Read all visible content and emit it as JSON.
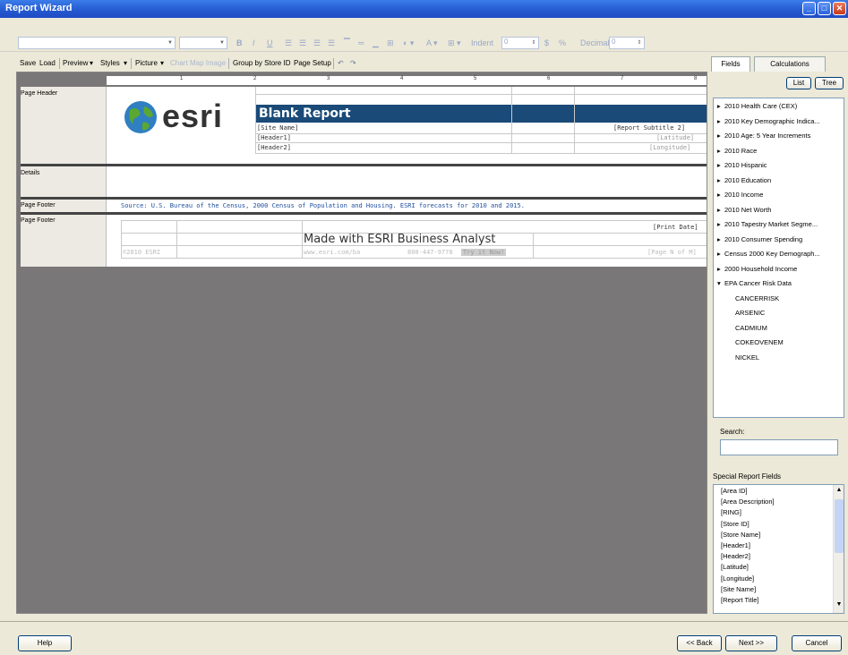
{
  "window": {
    "title": "Report Wizard"
  },
  "format_toolbar": {
    "font_combo": "",
    "size_combo": "",
    "bold": "B",
    "italic": "I",
    "underline": "U",
    "indent_label": "Indent",
    "indent_value": "0",
    "decimals_label": "Decimals",
    "decimals_value": "0",
    "currency": "$",
    "percent": "%"
  },
  "command_bar": {
    "save": "Save",
    "load": "Load",
    "preview": "Preview",
    "styles": "Styles",
    "picture": "Picture",
    "chart": "Chart",
    "map_image": "Map Image",
    "group_by": "Group by Store ID",
    "page_setup": "Page Setup"
  },
  "ruler": {
    "marks": [
      "1",
      "2",
      "3",
      "4",
      "5",
      "6",
      "7",
      "8"
    ]
  },
  "report": {
    "page_header_label": "Page Header",
    "details_label": "Details",
    "page_footer_label": "Page Footer",
    "page_footer2_label": "Page Footer",
    "logo_text": "esri",
    "blank_title": "Blank Report",
    "site_name": "[Site Name]",
    "subtitle": "[Report Subtitle 2]",
    "header1": "[Header1]",
    "header2": "[Header2]",
    "latitude": "[Latitude]",
    "longitude": "[Longitude]",
    "source": "Source: U.S. Bureau of the Census, 2000 Census of Population and Housing. ESRI forecasts for 2010 and 2015.",
    "print_date": "[Print Date]",
    "made_with": "Made with ESRI Business Analyst",
    "copyright": "©2010 ESRI",
    "website": "www.esri.com/ba",
    "phone": "800-447-9778",
    "try_it": "Try it Now!",
    "page_n": "[Page N of M]"
  },
  "right_panel": {
    "tabs": [
      "Fields",
      "Calculations"
    ],
    "list_btn": "List",
    "tree_btn": "Tree",
    "fields": [
      "2010 Health Care (CEX)",
      "2010 Key Demographic Indica...",
      "2010 Age: 5 Year Increments",
      "2010 Race",
      "2010 Hispanic",
      "2010 Education",
      "2010 Income",
      "2010 Net Worth",
      "2010 Tapestry Market Segme...",
      "2010 Consumer Spending",
      "Census 2000 Key Demograph...",
      "2000 Household Income",
      "EPA Cancer Risk Data"
    ],
    "epa_children": [
      "CANCERRISK",
      "ARSENIC",
      "CADMIUM",
      "COKEOVENEM",
      "NICKEL"
    ],
    "search_label": "Search:",
    "special_label": "Special Report Fields",
    "special_fields": [
      "[Area ID]",
      "[Area Description]",
      "[RING]",
      "[Store ID]",
      "[Store Name]",
      "[Header1]",
      "[Header2]",
      "[Latitude]",
      "[Longitude]",
      "[Site Name]",
      "[Report Title]"
    ]
  },
  "footer_buttons": {
    "help": "Help",
    "back": "<< Back",
    "next": "Next >>",
    "cancel": "Cancel"
  }
}
